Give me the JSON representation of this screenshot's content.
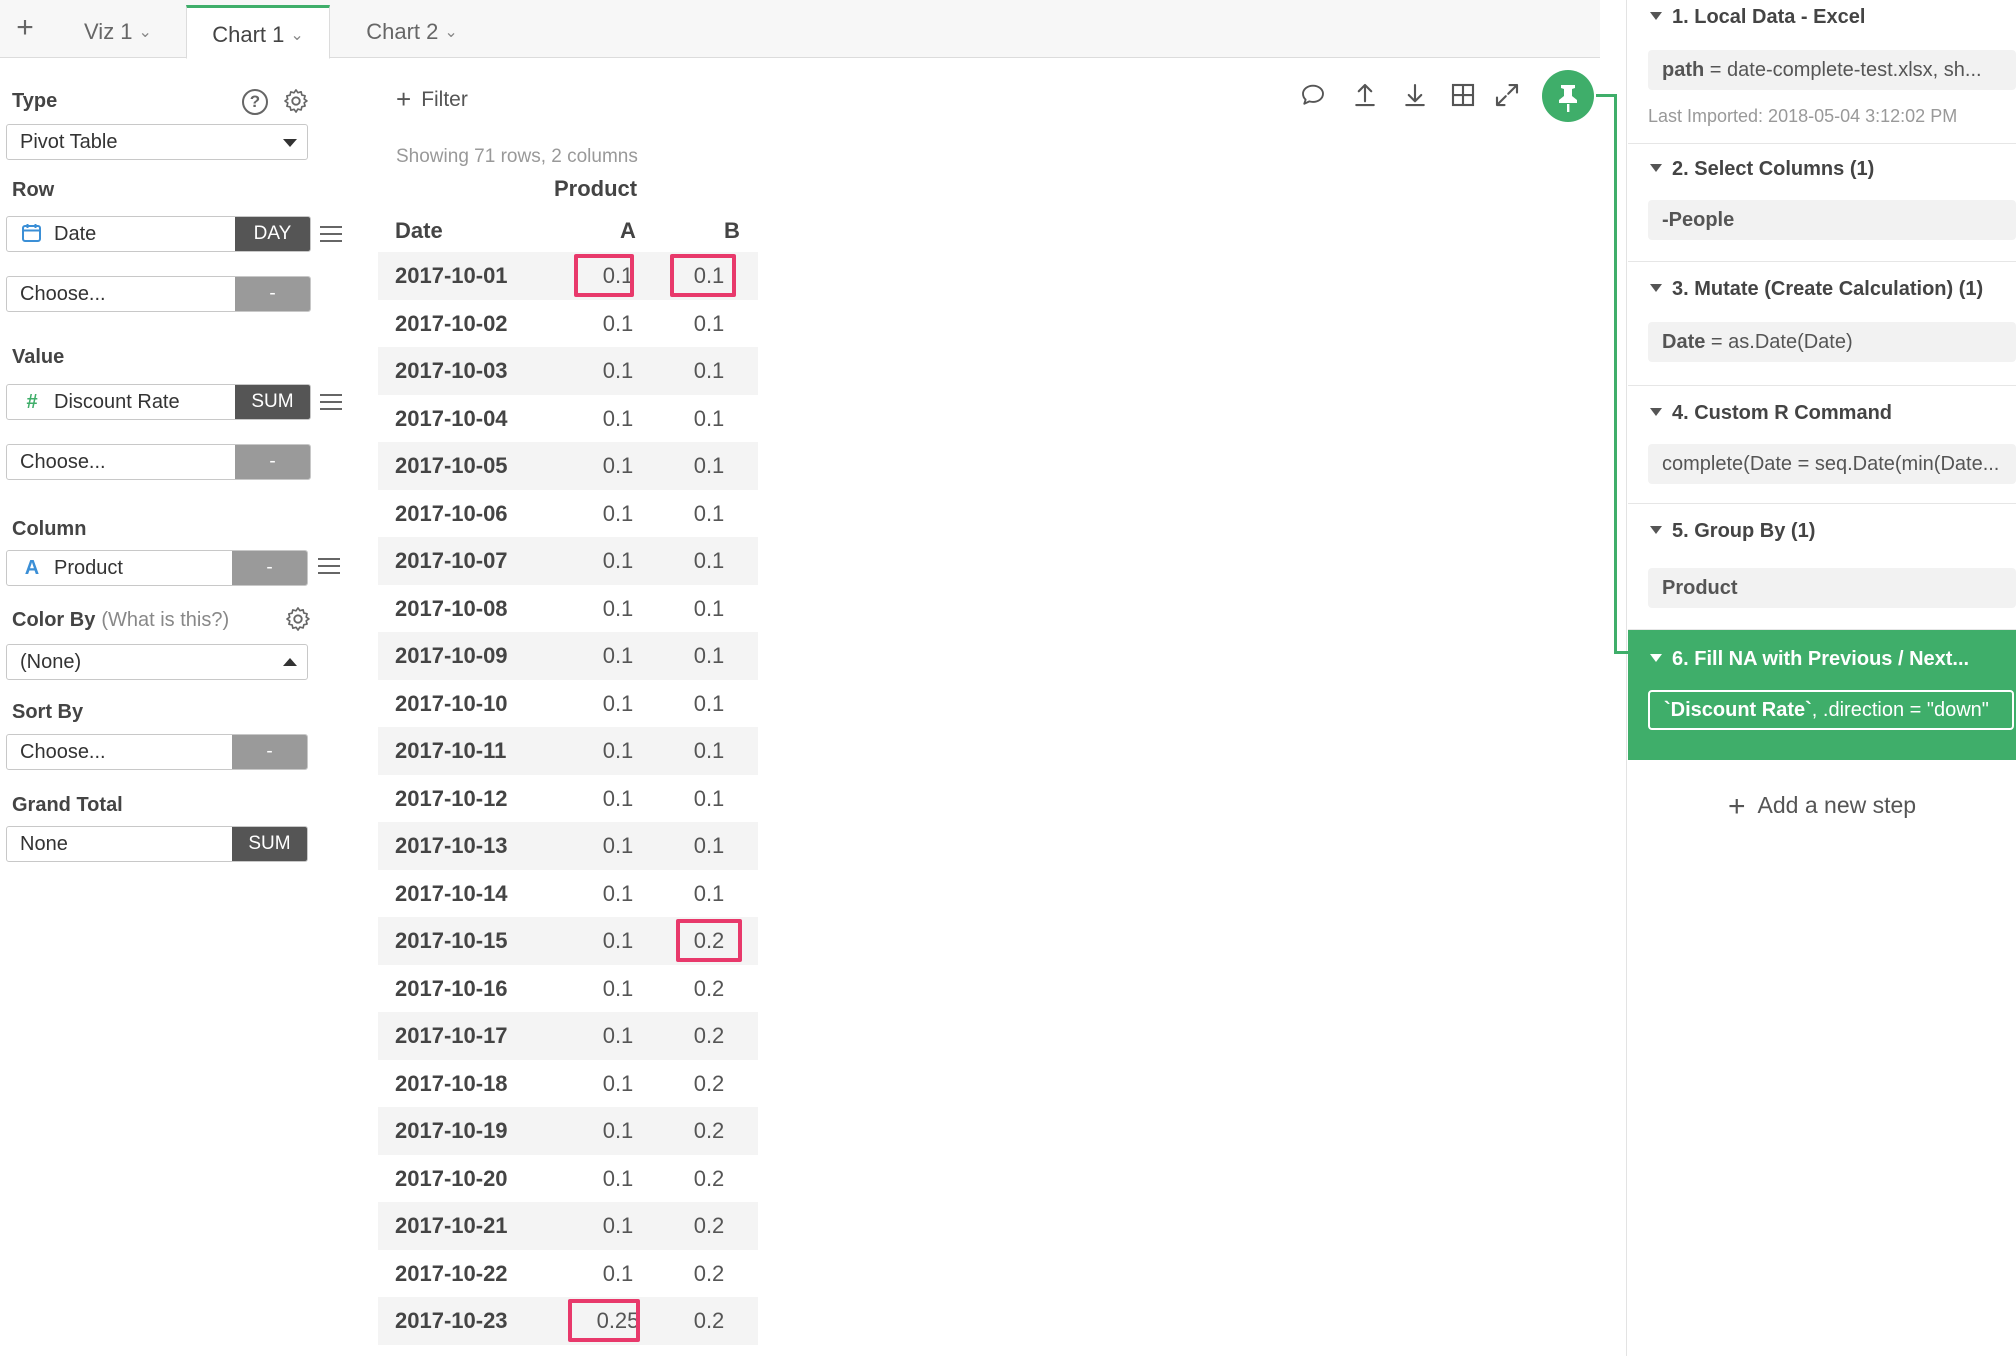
{
  "tabs": {
    "add_label": "+",
    "items": [
      {
        "label": "Viz 1"
      },
      {
        "label": "Chart 1",
        "active": true
      },
      {
        "label": "Chart 2"
      }
    ]
  },
  "config": {
    "type_label": "Type",
    "type_value": "Pivot Table",
    "row_label": "Row",
    "row_field": "Date",
    "row_agg": "DAY",
    "row_choose": "Choose...",
    "row_choose_agg": "-",
    "value_label": "Value",
    "value_field": "Discount Rate",
    "value_agg": "SUM",
    "value_choose": "Choose...",
    "value_choose_agg": "-",
    "column_label": "Column",
    "column_field": "Product",
    "column_agg": "-",
    "color_by_label": "Color By",
    "color_by_hint": "(What is this?)",
    "color_by_value": "(None)",
    "sort_by_label": "Sort By",
    "sort_by_value": "Choose...",
    "sort_by_agg": "-",
    "grand_total_label": "Grand Total",
    "grand_total_value": "None",
    "grand_total_agg": "SUM",
    "icons": {
      "help": "?",
      "date_icon": "calendar-icon",
      "number_icon": "#",
      "text_icon": "A"
    }
  },
  "main": {
    "filter_label": "Filter",
    "row_count": "Showing 71 rows, 2 columns",
    "table": {
      "group_header": "Product",
      "row_header": "Date",
      "col_a": "A",
      "col_b": "B",
      "rows": [
        {
          "date": "2017-10-01",
          "a": "0.1",
          "b": "0.1",
          "hl_a": true,
          "hl_b": true
        },
        {
          "date": "2017-10-02",
          "a": "0.1",
          "b": "0.1"
        },
        {
          "date": "2017-10-03",
          "a": "0.1",
          "b": "0.1"
        },
        {
          "date": "2017-10-04",
          "a": "0.1",
          "b": "0.1"
        },
        {
          "date": "2017-10-05",
          "a": "0.1",
          "b": "0.1"
        },
        {
          "date": "2017-10-06",
          "a": "0.1",
          "b": "0.1"
        },
        {
          "date": "2017-10-07",
          "a": "0.1",
          "b": "0.1"
        },
        {
          "date": "2017-10-08",
          "a": "0.1",
          "b": "0.1"
        },
        {
          "date": "2017-10-09",
          "a": "0.1",
          "b": "0.1"
        },
        {
          "date": "2017-10-10",
          "a": "0.1",
          "b": "0.1"
        },
        {
          "date": "2017-10-11",
          "a": "0.1",
          "b": "0.1"
        },
        {
          "date": "2017-10-12",
          "a": "0.1",
          "b": "0.1"
        },
        {
          "date": "2017-10-13",
          "a": "0.1",
          "b": "0.1"
        },
        {
          "date": "2017-10-14",
          "a": "0.1",
          "b": "0.1"
        },
        {
          "date": "2017-10-15",
          "a": "0.1",
          "b": "0.2",
          "hl_b": true
        },
        {
          "date": "2017-10-16",
          "a": "0.1",
          "b": "0.2"
        },
        {
          "date": "2017-10-17",
          "a": "0.1",
          "b": "0.2"
        },
        {
          "date": "2017-10-18",
          "a": "0.1",
          "b": "0.2"
        },
        {
          "date": "2017-10-19",
          "a": "0.1",
          "b": "0.2"
        },
        {
          "date": "2017-10-20",
          "a": "0.1",
          "b": "0.2"
        },
        {
          "date": "2017-10-21",
          "a": "0.1",
          "b": "0.2"
        },
        {
          "date": "2017-10-22",
          "a": "0.1",
          "b": "0.2"
        },
        {
          "date": "2017-10-23",
          "a": "0.25",
          "b": "0.2",
          "hl_a": true
        }
      ]
    }
  },
  "steps": {
    "items": [
      {
        "title": "1. Local Data - Excel",
        "box_key": "path",
        "box_rest": " = date-complete-test.xlsx, sh...",
        "meta": "Last Imported: 2018-05-04 3:12:02 PM"
      },
      {
        "title": "2. Select Columns (1)",
        "box_key": "-People",
        "box_rest": ""
      },
      {
        "title": "3. Mutate (Create Calculation) (1)",
        "box_key": "Date",
        "box_rest": " = as.Date(Date)"
      },
      {
        "title": "4. Custom R Command",
        "box_key": "",
        "box_rest": "complete(Date = seq.Date(min(Date..."
      },
      {
        "title": "5. Group By (1)",
        "box_key": "Product",
        "box_rest": ""
      },
      {
        "title": "6. Fill NA with Previous / Next...",
        "box_key": "`Discount Rate`",
        "box_rest": ", .direction = \"down\"",
        "active": true
      }
    ],
    "add_label": "Add a new step"
  },
  "colors": {
    "accent": "#3fae6a",
    "highlight": "#e8396b",
    "agg_dark": "#555555",
    "agg_gray": "#9a9a9a"
  }
}
